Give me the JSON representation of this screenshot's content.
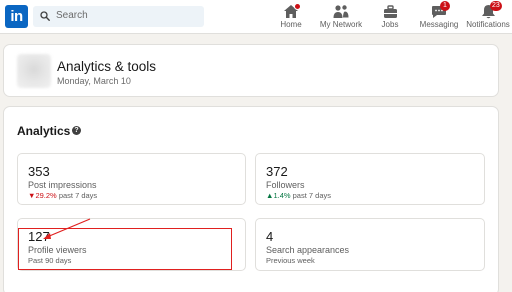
{
  "nav": {
    "logo": "in",
    "search_placeholder": "Search",
    "items": [
      {
        "label": "Home",
        "icon": "home-icon"
      },
      {
        "label": "My Network",
        "icon": "network-icon"
      },
      {
        "label": "Jobs",
        "icon": "jobs-icon"
      },
      {
        "label": "Messaging",
        "icon": "messaging-icon",
        "badge": "1"
      },
      {
        "label": "Notifications",
        "icon": "bell-icon",
        "badge": "23"
      }
    ]
  },
  "header": {
    "title": "Analytics & tools",
    "date": "Monday, March 10"
  },
  "analytics": {
    "title": "Analytics",
    "help_glyph": "?",
    "stats": [
      {
        "value": "353",
        "label": "Post impressions",
        "change": "29.2%",
        "direction": "down",
        "period": "past 7 days"
      },
      {
        "value": "372",
        "label": "Followers",
        "change": "1.4%",
        "direction": "up",
        "period": "past 7 days"
      },
      {
        "value": "127",
        "label": "Profile viewers",
        "period": "Past 90 days"
      },
      {
        "value": "4",
        "label": "Search appearances",
        "period": "Previous week"
      }
    ]
  },
  "colors": {
    "brand": "#0a66c2",
    "badge": "#cc1016",
    "down": "#cc1016",
    "up": "#057642",
    "annotation": "#e0201f"
  }
}
